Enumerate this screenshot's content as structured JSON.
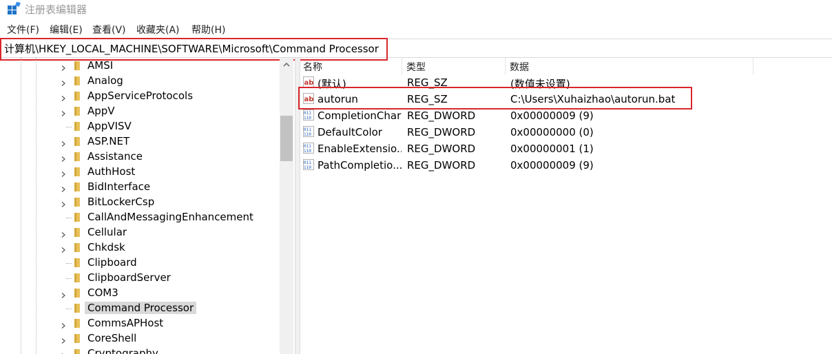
{
  "window": {
    "title": "注册表编辑器"
  },
  "menu": [
    "文件(F)",
    "编辑(E)",
    "查看(V)",
    "收藏夹(A)",
    "帮助(H)"
  ],
  "address": {
    "path": "计算机\\HKEY_LOCAL_MACHINE\\SOFTWARE\\Microsoft\\Command Processor"
  },
  "tree": {
    "items": [
      {
        "label": "AMSI",
        "expandable": true
      },
      {
        "label": "Analog",
        "expandable": true
      },
      {
        "label": "AppServiceProtocols",
        "expandable": true
      },
      {
        "label": "AppV",
        "expandable": true
      },
      {
        "label": "AppVISV",
        "expandable": false
      },
      {
        "label": "ASP.NET",
        "expandable": true
      },
      {
        "label": "Assistance",
        "expandable": true
      },
      {
        "label": "AuthHost",
        "expandable": true
      },
      {
        "label": "BidInterface",
        "expandable": true
      },
      {
        "label": "BitLockerCsp",
        "expandable": true
      },
      {
        "label": "CallAndMessagingEnhancement",
        "expandable": false
      },
      {
        "label": "Cellular",
        "expandable": true
      },
      {
        "label": "Chkdsk",
        "expandable": true
      },
      {
        "label": "Clipboard",
        "expandable": false
      },
      {
        "label": "ClipboardServer",
        "expandable": false
      },
      {
        "label": "COM3",
        "expandable": true
      },
      {
        "label": "Command Processor",
        "expandable": false,
        "selected": true
      },
      {
        "label": "CommsAPHost",
        "expandable": true
      },
      {
        "label": "CoreShell",
        "expandable": true
      },
      {
        "label": "Cryptography",
        "expandable": true
      }
    ]
  },
  "values": {
    "headers": {
      "name": "名称",
      "type": "类型",
      "data": "数据"
    },
    "rows": [
      {
        "name": "(默认)",
        "type": "REG_SZ",
        "data": "(数值未设置)",
        "icon": "string-value-icon"
      },
      {
        "name": "autorun",
        "type": "REG_SZ",
        "data": "C:\\Users\\Xuhaizhao\\autorun.bat",
        "icon": "string-value-icon"
      },
      {
        "name": "CompletionChar",
        "type": "REG_DWORD",
        "data": "0x00000009 (9)",
        "icon": "binary-value-icon"
      },
      {
        "name": "DefaultColor",
        "type": "REG_DWORD",
        "data": "0x00000000 (0)",
        "icon": "binary-value-icon"
      },
      {
        "name": "EnableExtensio...",
        "type": "REG_DWORD",
        "data": "0x00000001 (1)",
        "icon": "binary-value-icon"
      },
      {
        "name": "PathCompletio...",
        "type": "REG_DWORD",
        "data": "0x00000009 (9)",
        "icon": "binary-value-icon"
      }
    ]
  },
  "colors": {
    "highlight_box": "#d9262b",
    "selection": "#d9d9d9",
    "folder": "#e8c15a"
  }
}
